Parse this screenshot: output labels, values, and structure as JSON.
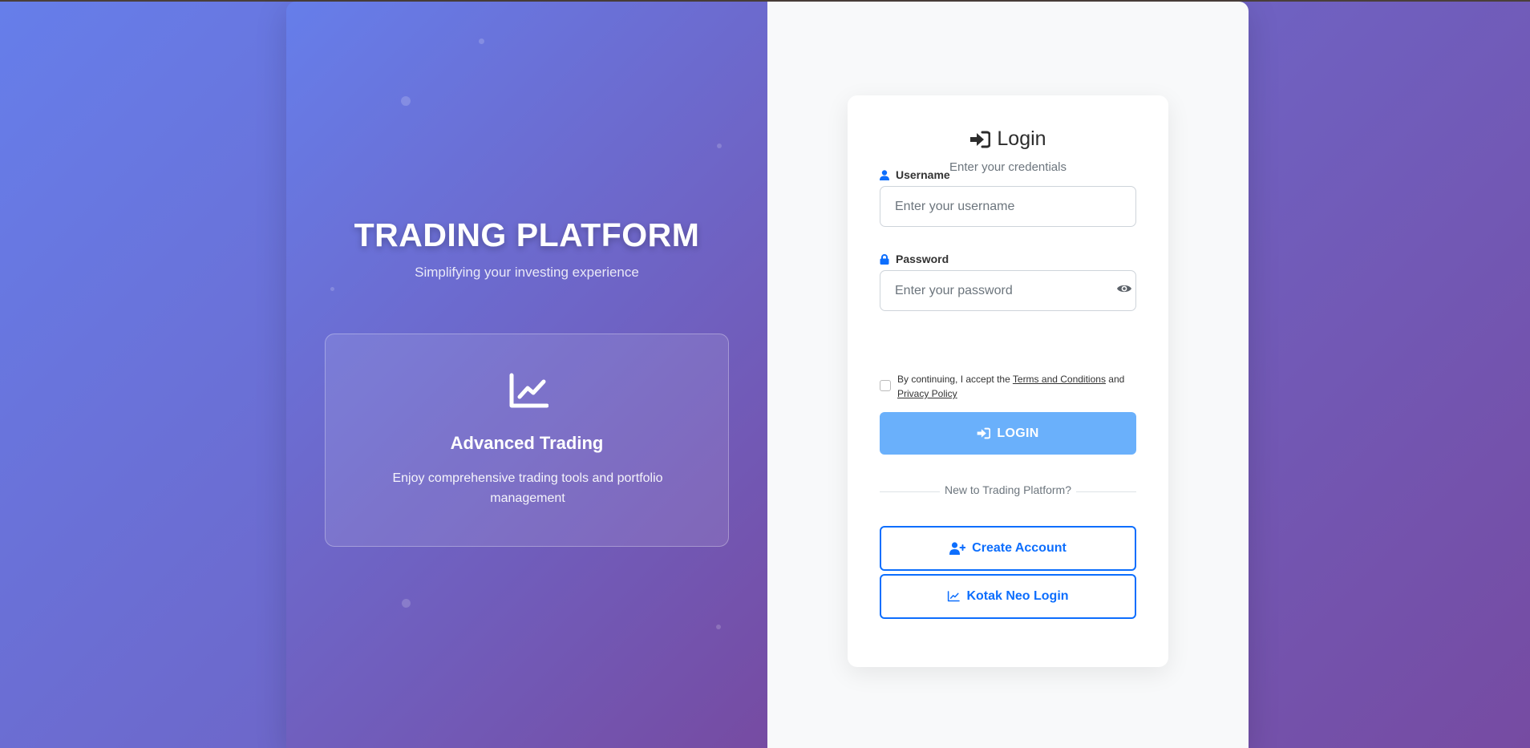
{
  "brand": {
    "title": "TRADING PLATFORM",
    "subtitle": "Simplifying your investing experience"
  },
  "feature": {
    "icon": "chart-line-icon",
    "title": "Advanced Trading",
    "description": "Enjoy comprehensive trading tools and portfolio management"
  },
  "login": {
    "title": "Login",
    "title_icon": "sign-in-icon",
    "subtitle": "Enter your credentials",
    "username_label": "Username",
    "username_placeholder": "Enter your username",
    "password_label": "Password",
    "password_placeholder": "Enter your password",
    "terms_prefix": "By continuing, I accept the",
    "terms_link": "Terms and Conditions",
    "terms_and": "and",
    "privacy_link": "Privacy Policy",
    "login_button": "LOGIN",
    "divider_text": "New to Trading Platform?",
    "create_account_button": "Create Account",
    "kotak_button": "Kotak Neo Login"
  },
  "colors": {
    "gradient_start": "#667eea",
    "gradient_end": "#764ba2",
    "primary": "#0d6efd",
    "login_button_bg": "#6ab0fb"
  }
}
